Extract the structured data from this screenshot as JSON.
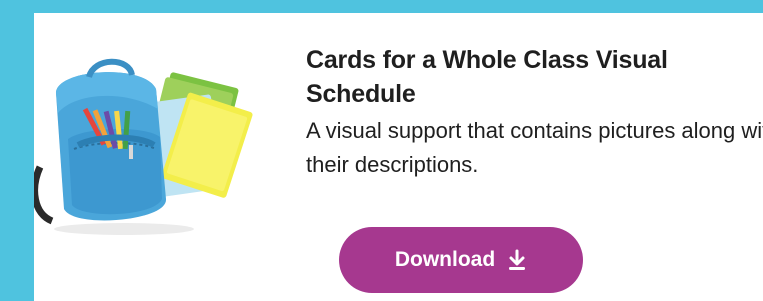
{
  "card": {
    "title": "Cards for a Whole Class Visual Schedule",
    "description": "A visual support that contains pictures along with their descriptions.",
    "download_label": "Download",
    "download_icon": "download-arrow-icon",
    "image": "backpack-with-notebooks-illustration"
  },
  "colors": {
    "page_background": "#4fc3df",
    "card_background": "#ffffff",
    "button_background": "#a6388f",
    "button_text": "#ffffff",
    "text": "#1f1f1f"
  }
}
